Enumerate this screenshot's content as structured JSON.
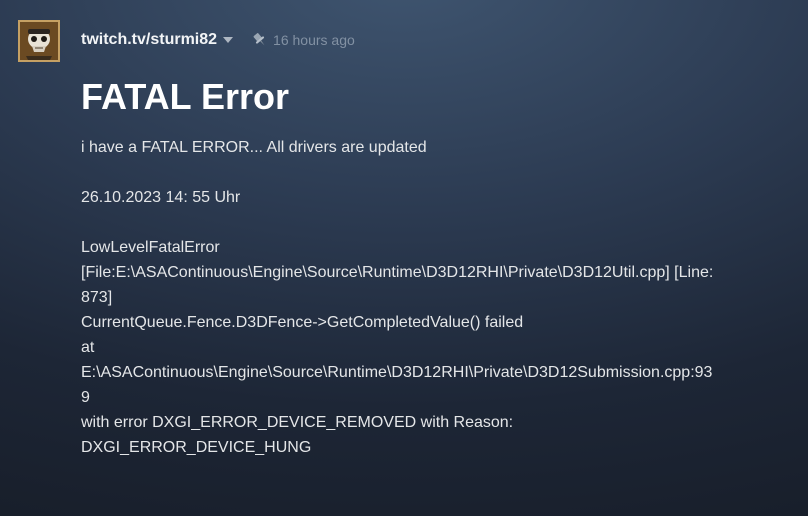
{
  "post": {
    "author": "twitch.tv/sturmi82",
    "timestamp": "16 hours ago",
    "title": "FATAL Error",
    "body": {
      "intro": "i have a FATAL ERROR... All drivers are updated",
      "datetime": "26.10.2023 14: 55 Uhr",
      "error_lines": [
        "LowLevelFatalError",
        "[File:E:\\ASAContinuous\\Engine\\Source\\Runtime\\D3D12RHI\\Private\\D3D12Util.cpp] [Line:",
        "873]",
        "CurrentQueue.Fence.D3DFence->GetCompletedValue() failed",
        "at",
        "E:\\ASAContinuous\\Engine\\Source\\Runtime\\D3D12RHI\\Private\\D3D12Submission.cpp:93",
        "9",
        "with error DXGI_ERROR_DEVICE_REMOVED with Reason:",
        "DXGI_ERROR_DEVICE_HUNG"
      ]
    }
  },
  "icons": {
    "avatar": "user-avatar",
    "dropdown": "chevron-down-icon",
    "pin": "pushpin-icon"
  },
  "colors": {
    "background_top": "#3f5570",
    "background_bottom": "#171d28",
    "timestamp": "#8291a3",
    "avatar_border": "#c5a063"
  }
}
